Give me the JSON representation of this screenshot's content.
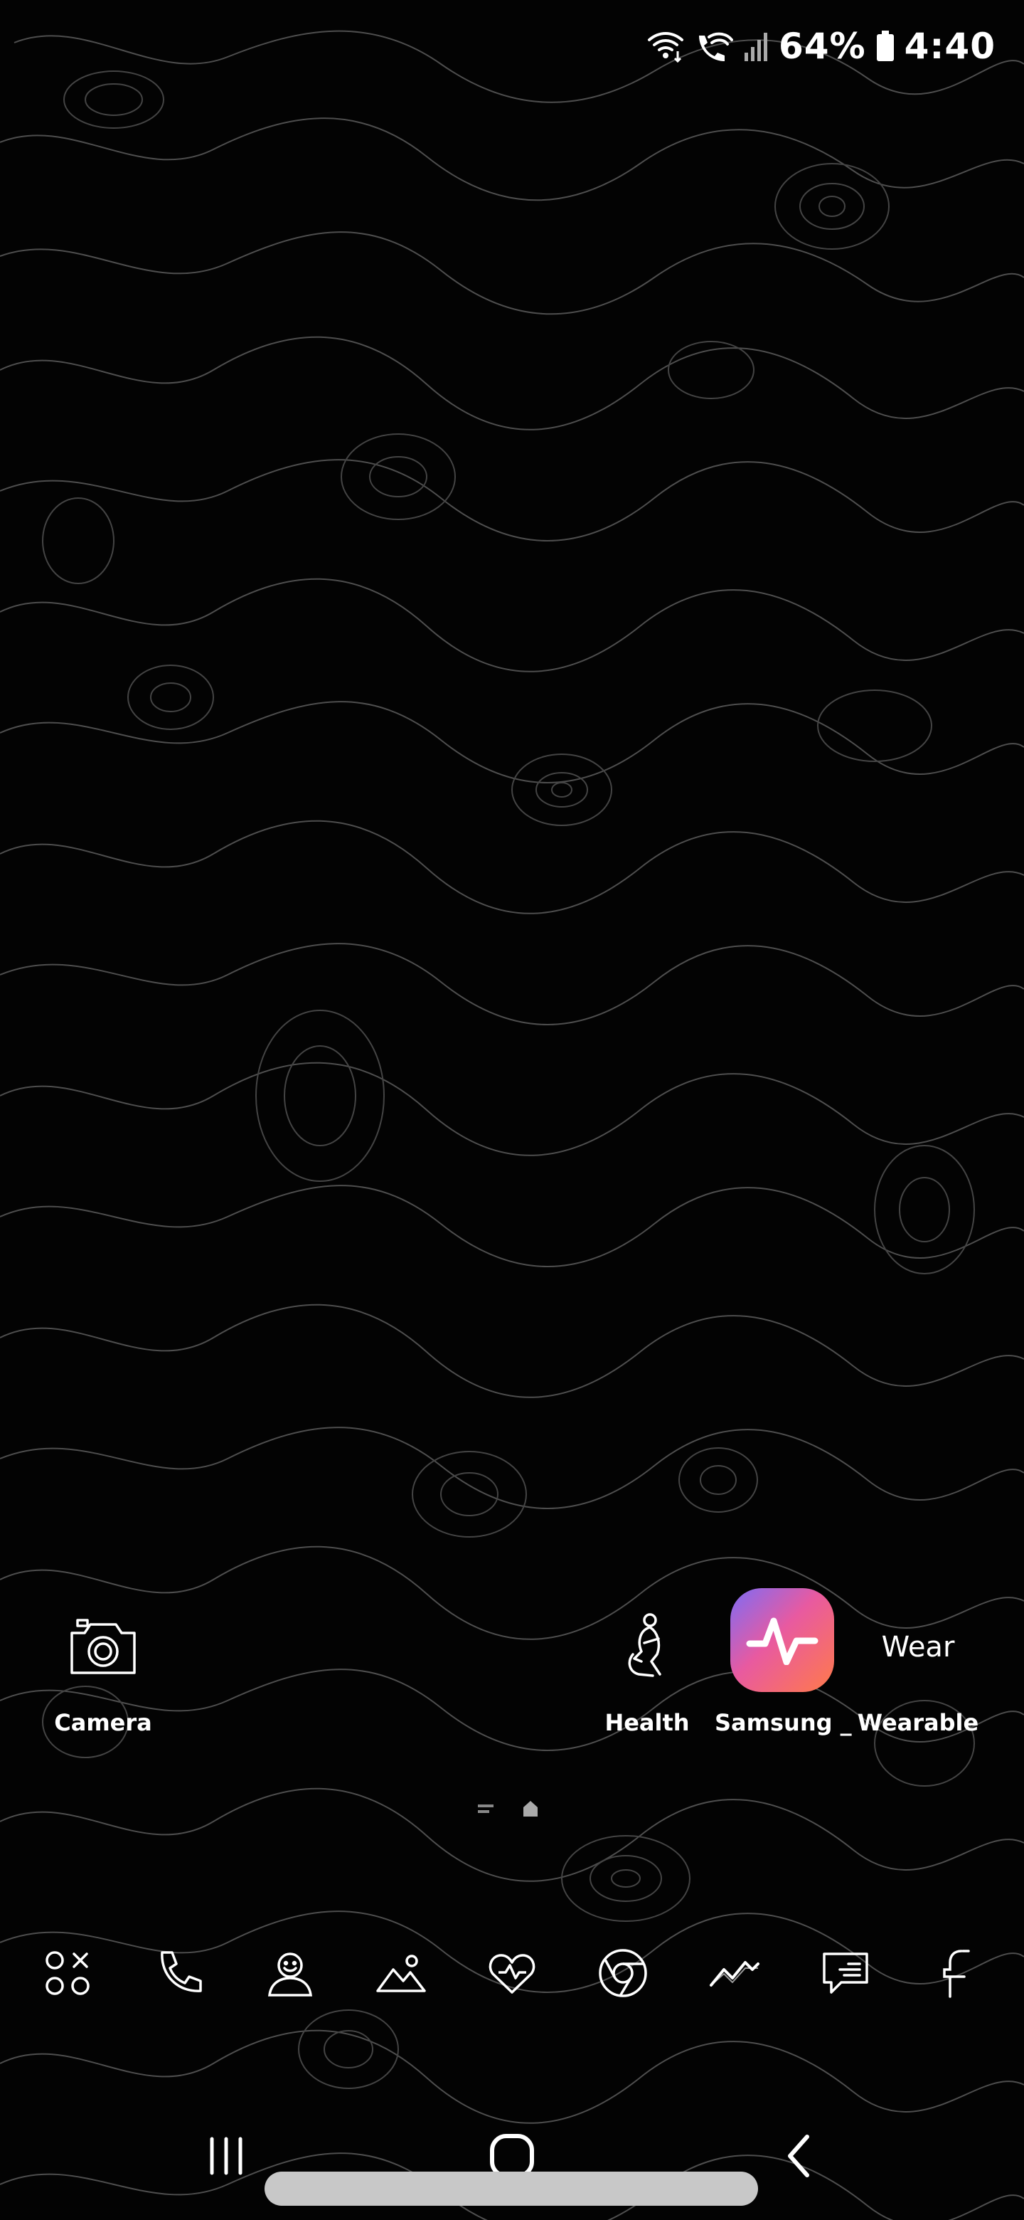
{
  "status_bar": {
    "battery_percent": "64%",
    "time": "4:40",
    "icons": [
      "wifi-icon",
      "wifi-calling-icon",
      "signal-icon",
      "battery-icon"
    ]
  },
  "home_apps": [
    {
      "label": "Camera",
      "icon": "camera-icon"
    },
    {
      "label": "Health",
      "icon": "health-icon"
    },
    {
      "label": "Samsung _",
      "icon": "samsung-health-icon"
    },
    {
      "label": "Wearable",
      "icon": "wearable-icon",
      "icon_text": "Wear"
    }
  ],
  "page_indicator": {
    "pages": 2,
    "current": "home"
  },
  "dock": [
    {
      "icon": "apps-icon"
    },
    {
      "icon": "phone-icon"
    },
    {
      "icon": "contacts-icon"
    },
    {
      "icon": "gallery-icon"
    },
    {
      "icon": "health-heart-icon"
    },
    {
      "icon": "chrome-icon"
    },
    {
      "icon": "activity-icon"
    },
    {
      "icon": "messages-icon"
    },
    {
      "icon": "facebook-icon"
    }
  ],
  "nav_bar": {
    "buttons": [
      "recents-icon",
      "home-icon",
      "back-icon"
    ]
  },
  "colors": {
    "background": "#030303",
    "contour": "#5a5a5a",
    "text": "#ffffff",
    "samsung_gradient_start": "#7d6cf6",
    "samsung_gradient_end": "#ff7a4a"
  }
}
